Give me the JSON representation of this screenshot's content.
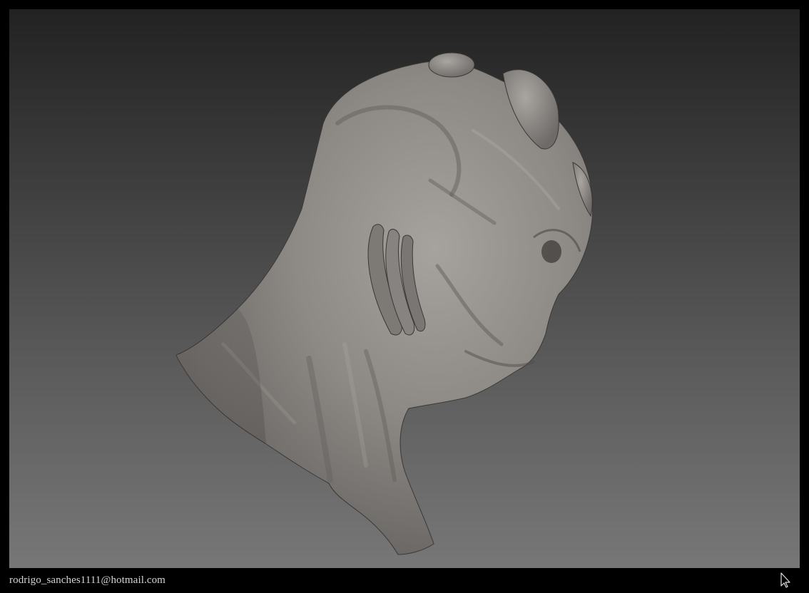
{
  "footer": {
    "signature_text": "rodrigo_sanches1111@hotmail.com"
  },
  "icons": {
    "cursor": "arrow-pointer-icon"
  },
  "colors": {
    "background_top": "#222222",
    "background_bottom": "#777777",
    "clay": "#8c8884",
    "frame": "#000000",
    "signature": "#d4d4d4"
  }
}
